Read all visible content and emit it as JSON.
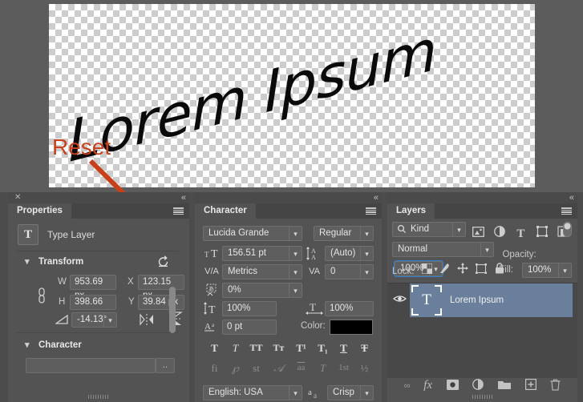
{
  "canvas": {
    "artwork_text": "Lorem Ipsum",
    "annotation_label": "Reset",
    "annotation_color": "#C8401A"
  },
  "properties_panel": {
    "tab_label": "Properties",
    "layer_type_label": "Type Layer",
    "layer_type_icon": "T",
    "transform": {
      "section_label": "Transform",
      "reset_icon": "reset-arrow-icon",
      "w_label": "W",
      "w_value": "953.69 px",
      "h_label": "H",
      "h_value": "398.66 px",
      "x_label": "X",
      "x_value": "123.15 px",
      "y_label": "Y",
      "y_value": "39.84 px",
      "angle_value": "-14.13°",
      "link_icon": "link-chain-icon",
      "angle_icon": "angle-icon",
      "flip_h_icon": "flip-horizontal-icon",
      "flip_v_icon": "flip-vertical-icon"
    },
    "character": {
      "section_label": "Character",
      "font_value": ""
    }
  },
  "character_panel": {
    "tab_label": "Character",
    "font_family": "Lucida Grande",
    "font_style": "Regular",
    "font_size": "156.51 pt",
    "leading": "(Auto)",
    "kerning": "Metrics",
    "tracking": "0",
    "vertical_scale_pct": "0%",
    "vscale": "100%",
    "hscale": "100%",
    "baseline_shift": "0 pt",
    "color_label": "Color:",
    "color_value": "#000000",
    "style_buttons": [
      {
        "name": "faux-bold-button",
        "glyph": "T"
      },
      {
        "name": "faux-italic-button",
        "glyph": "T"
      },
      {
        "name": "all-caps-button",
        "glyph": "TT"
      },
      {
        "name": "small-caps-button",
        "glyph": "Tᴛ"
      },
      {
        "name": "superscript-button",
        "glyph": "T¹"
      },
      {
        "name": "subscript-button",
        "glyph": "T₁"
      },
      {
        "name": "underline-button",
        "glyph": "T"
      },
      {
        "name": "strikethrough-button",
        "glyph": "T"
      }
    ],
    "opentype_buttons": [
      {
        "name": "standard-ligatures-button",
        "glyph": "fi"
      },
      {
        "name": "contextual-alternates-button",
        "glyph": "℘"
      },
      {
        "name": "discretionary-ligatures-button",
        "glyph": "st"
      },
      {
        "name": "swash-button",
        "glyph": "𝒜"
      },
      {
        "name": "titling-alternates-button",
        "glyph": "aa"
      },
      {
        "name": "stylistic-alternates-button",
        "glyph": "T"
      },
      {
        "name": "ordinals-button",
        "glyph": "1st"
      },
      {
        "name": "fractions-button",
        "glyph": "½"
      }
    ],
    "language": "English: USA",
    "antialias_label_icon": "anti-alias-icon",
    "antialias": "Crisp"
  },
  "layers_panel": {
    "tab_label": "Layers",
    "filter_kind": "Kind",
    "filter_icons": [
      "pixel-layer-filter-icon",
      "adjustment-layer-filter-icon",
      "type-layer-filter-icon",
      "shape-layer-filter-icon",
      "smart-object-filter-icon"
    ],
    "filter_toggle_icon": "filter-toggle-switch",
    "blend_mode": "Normal",
    "opacity_label": "Opacity:",
    "opacity_value": "100%",
    "lock_label": "Lock:",
    "lock_icons": [
      "lock-transparent-pixels-icon",
      "lock-image-pixels-icon",
      "lock-position-icon",
      "lock-artboard-nesting-icon",
      "lock-all-icon"
    ],
    "fill_label": "Fill:",
    "fill_value": "100%",
    "layers": [
      {
        "name": "Lorem Ipsum",
        "thumb_glyph": "T",
        "visible": true,
        "selected": true
      }
    ],
    "bottom_icons": [
      "link-layers-icon",
      "layer-style-fx-icon",
      "layer-mask-icon",
      "new-adjustment-layer-icon",
      "new-group-icon",
      "new-layer-icon",
      "delete-layer-icon"
    ],
    "bottom_icon_glyphs": [
      "GD",
      "fx",
      "■",
      "◑",
      "▬",
      "+",
      "🗑"
    ],
    "focus_accent": "#2B7FD4"
  }
}
